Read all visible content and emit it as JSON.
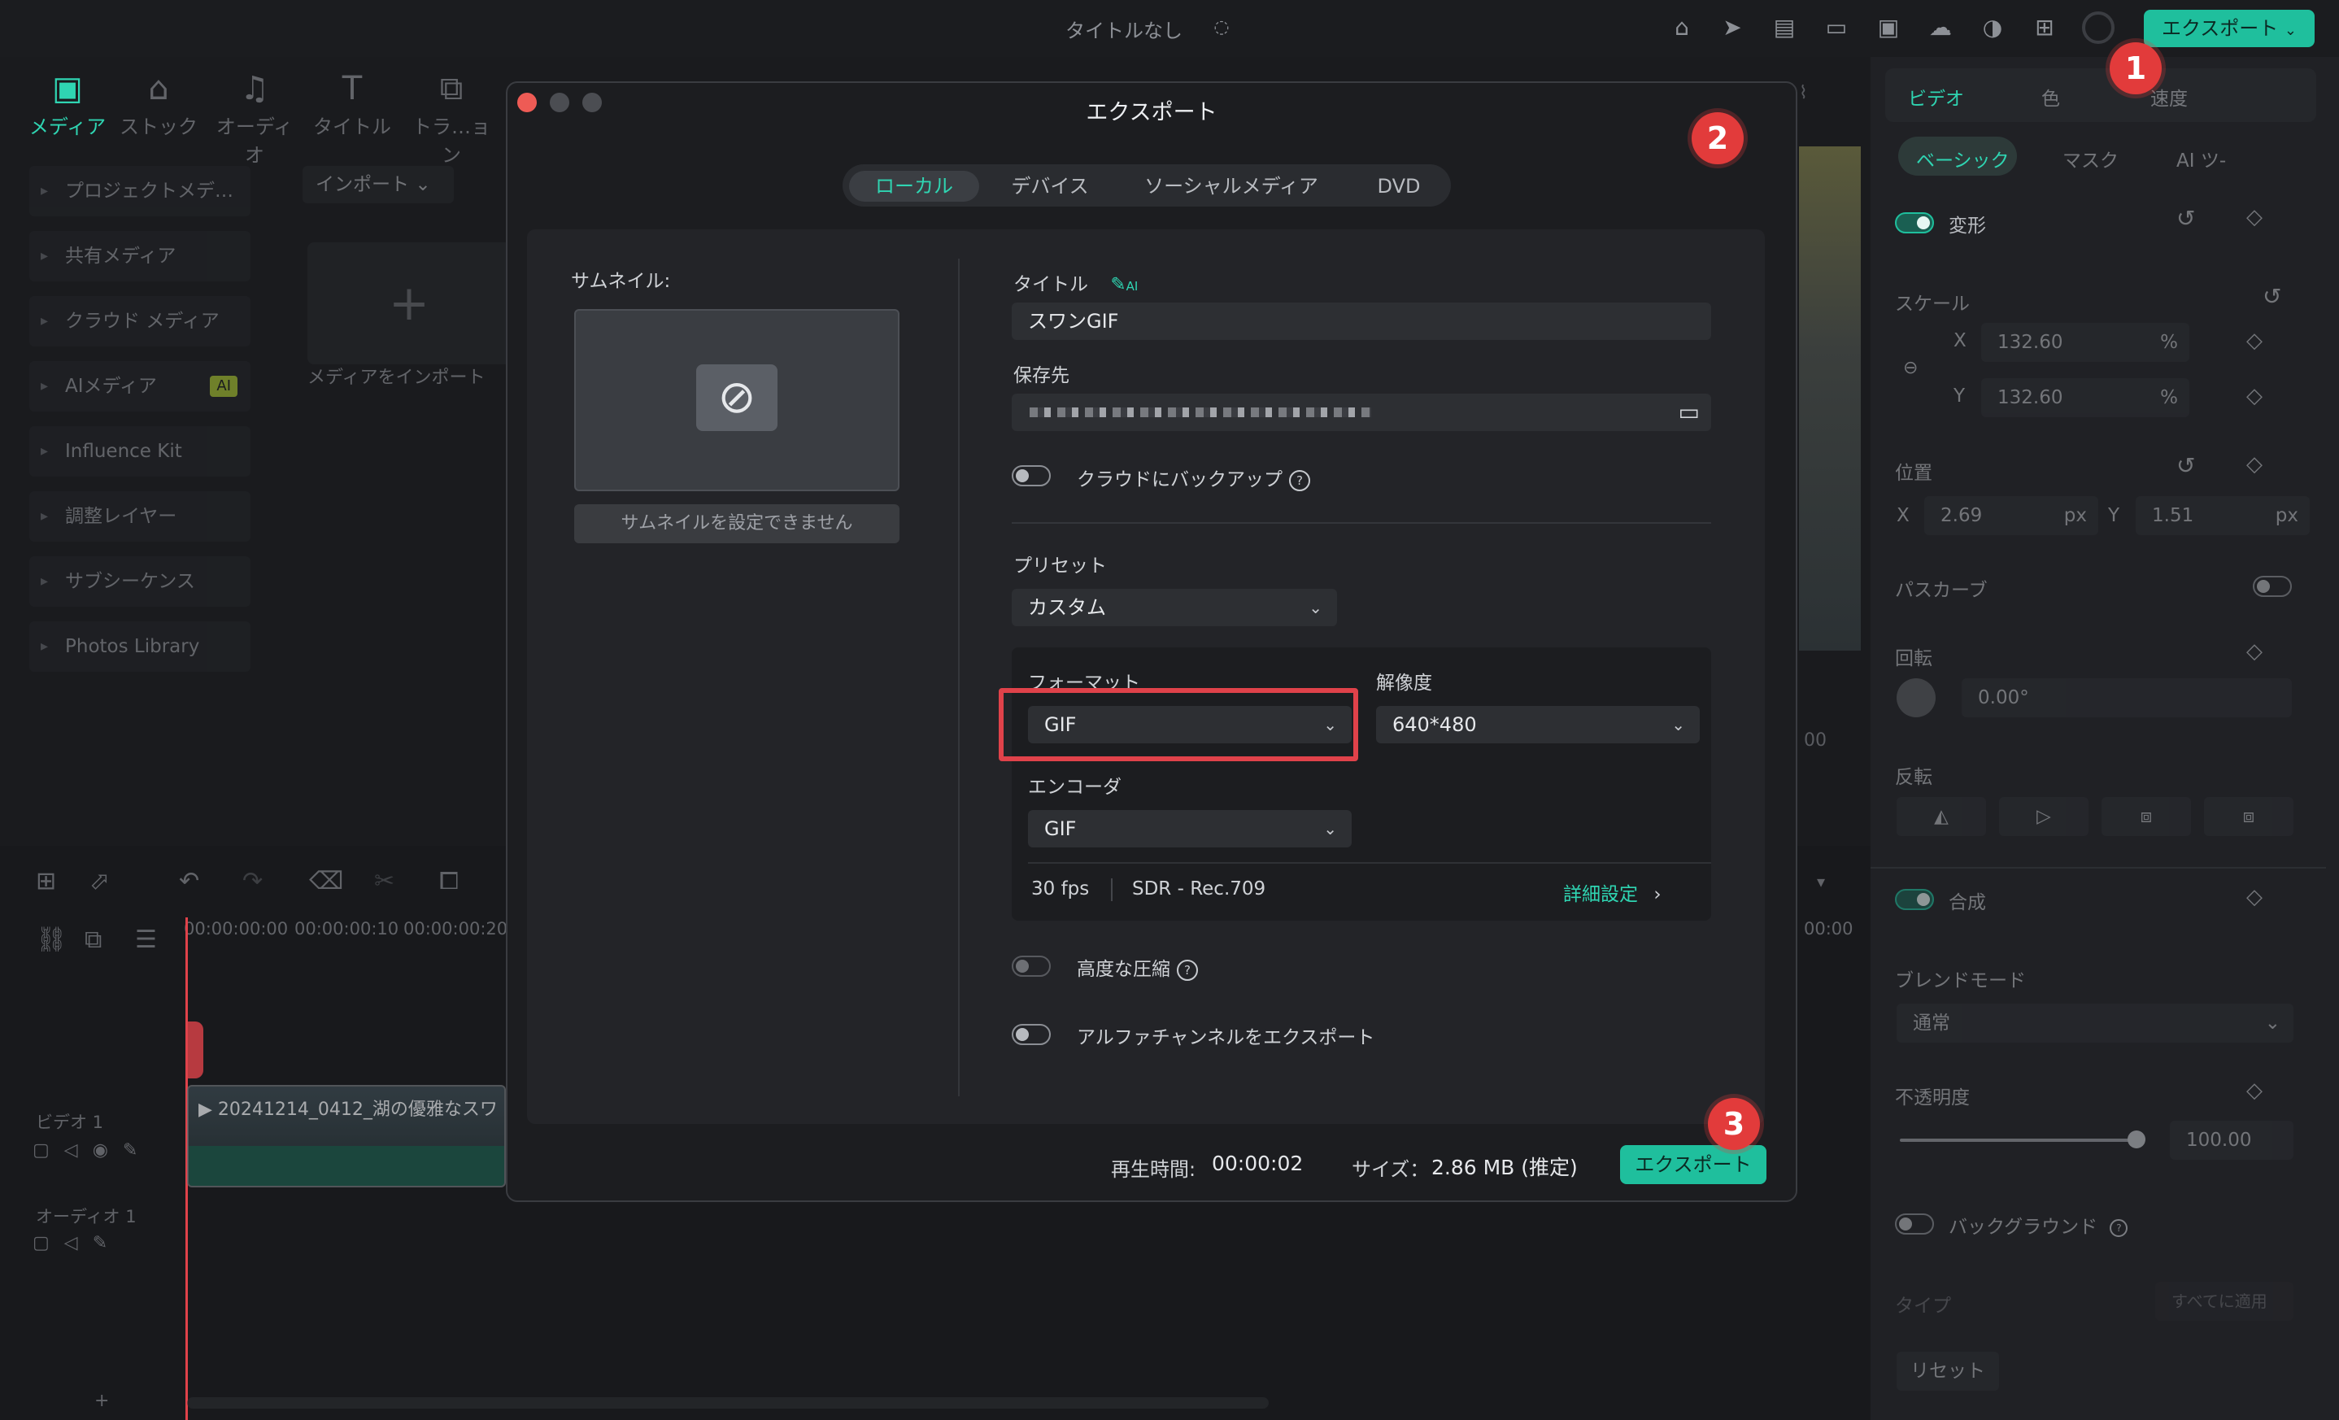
{
  "app": {
    "title": "タイトルなし",
    "export_label": "エクスポート"
  },
  "toolbar": [
    "メディア",
    "ストック",
    "オーディオ",
    "タイトル",
    "トラ…ョン"
  ],
  "sidebar": {
    "items": [
      "プロジェクトメデ…",
      "共有メディア",
      "クラウド メディア",
      "AIメディア",
      "Influence Kit",
      "調整レイヤー",
      "サブシーケンス",
      "Photos Library"
    ],
    "ai_badge": "AI",
    "import_dropdown": "インポート",
    "import_media": "メディアをインポート"
  },
  "right_panel": {
    "tabs": [
      "ビデオ",
      "色",
      "速度"
    ],
    "subtabs": [
      "ベーシック",
      "マスク",
      "AI ツ-"
    ],
    "transform": "変形",
    "scale": "スケール",
    "scale_x": "132.60",
    "scale_y": "132.60",
    "percent": "%",
    "position": "位置",
    "pos_x": "2.69",
    "pos_y": "1.51",
    "px": "px",
    "x": "X",
    "y": "Y",
    "path_curve": "パスカーブ",
    "rotation": "回転",
    "rotation_value": "0.00°",
    "flip": "反転",
    "composite": "合成",
    "blend_mode": "ブレンドモード",
    "blend_value": "通常",
    "opacity": "不透明度",
    "opacity_value": "100.00",
    "background": "バックグラウンド",
    "type": "タイプ",
    "apply_all": "すべてに適用",
    "reset": "リセット"
  },
  "timeline": {
    "timecodes": [
      "00:00:00:00",
      "00:00:00:10",
      "00:00:00:20"
    ],
    "video_track": "ビデオ 1",
    "audio_track": "オーディオ 1",
    "clip_name": "20241214_0412_湖の優雅なスワ",
    "right_tc_1": "00",
    "right_tc_2": "00:00"
  },
  "export_dialog": {
    "title": "エクスポート",
    "tabs": [
      "ローカル",
      "デバイス",
      "ソーシャルメディア",
      "DVD"
    ],
    "thumbnail_label": "サムネイル:",
    "thumbnail_button": "サムネイルを設定できません",
    "title_label": "タイトル",
    "ai_mark": "AI",
    "title_value": "スワンGIF",
    "save_label": "保存先",
    "cloud_backup": "クラウドにバックアップ",
    "preset_label": "プリセット",
    "preset_value": "カスタム",
    "format_label": "フォーマット",
    "format_value": "GIF",
    "resolution_label": "解像度",
    "resolution_value": "640*480",
    "encoder_label": "エンコーダ",
    "encoder_value": "GIF",
    "fps": "30 fps",
    "color_space": "SDR - Rec.709",
    "advanced": "詳細設定",
    "high_compression": "高度な圧縮",
    "alpha_export": "アルファチャンネルをエクスポート",
    "duration_label": "再生時間:",
    "duration_value": "00:00:02",
    "size_label": "サイズ：",
    "size_value": "2.86 MB (推定)",
    "export_button": "エクスポート"
  },
  "annotations": [
    "1",
    "2",
    "3"
  ],
  "colors": {
    "accent": "#1fbf9d",
    "highlight_box": "#e0424a",
    "badge": "#e23b3b"
  }
}
